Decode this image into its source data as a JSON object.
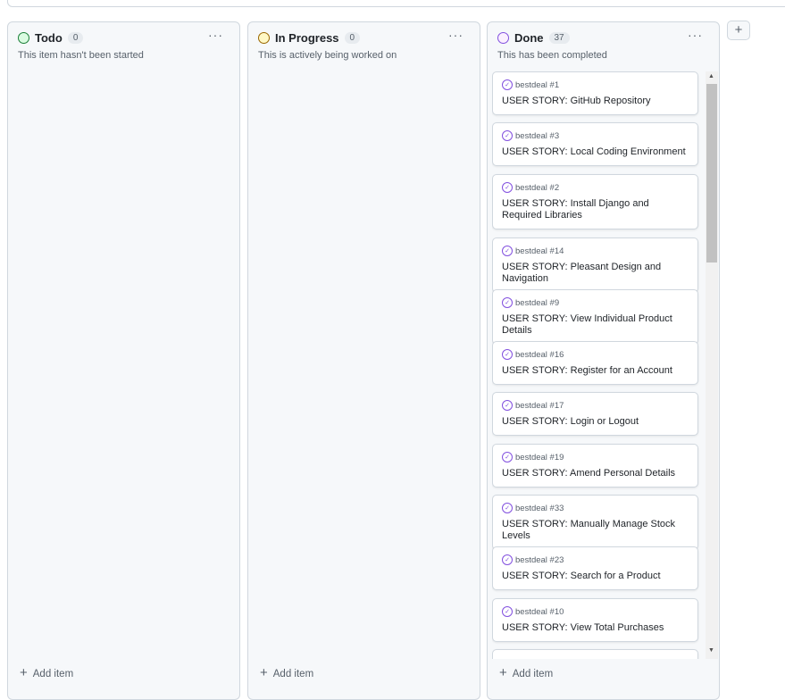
{
  "columns": [
    {
      "title": "Todo",
      "count": "0",
      "description": "This item hasn't been started",
      "color": "#1a7f37",
      "fill": "#dafbe1",
      "add_label": "Add item",
      "cards": []
    },
    {
      "title": "In Progress",
      "count": "0",
      "description": "This is actively being worked on",
      "color": "#9a6700",
      "fill": "#fff8c5",
      "add_label": "Add item",
      "cards": []
    },
    {
      "title": "Done",
      "count": "37",
      "description": "This has been completed",
      "color": "#8250df",
      "fill": "#fbefff",
      "add_label": "Add item",
      "cards": [
        {
          "ref": "bestdeal #1",
          "title": "USER STORY: GitHub Repository"
        },
        {
          "ref": "bestdeal #3",
          "title": "USER STORY: Local Coding Environment"
        },
        {
          "ref": "bestdeal #2",
          "title": "USER STORY: Install Django and Required Libraries"
        },
        {
          "ref": "bestdeal #14",
          "title": "USER STORY: Pleasant Design and Navigation"
        },
        {
          "ref": "bestdeal #9",
          "title": "USER STORY: View Individual Product Details"
        },
        {
          "ref": "bestdeal #16",
          "title": "USER STORY: Register for an Account"
        },
        {
          "ref": "bestdeal #17",
          "title": "USER STORY: Login or Logout"
        },
        {
          "ref": "bestdeal #19",
          "title": "USER STORY: Amend Personal Details"
        },
        {
          "ref": "bestdeal #33",
          "title": "USER STORY: Manually Manage Stock Levels"
        },
        {
          "ref": "bestdeal #23",
          "title": "USER STORY: Search for a Product"
        },
        {
          "ref": "bestdeal #10",
          "title": "USER STORY: View Total Purchases"
        }
      ]
    }
  ],
  "add_column_label": "+"
}
